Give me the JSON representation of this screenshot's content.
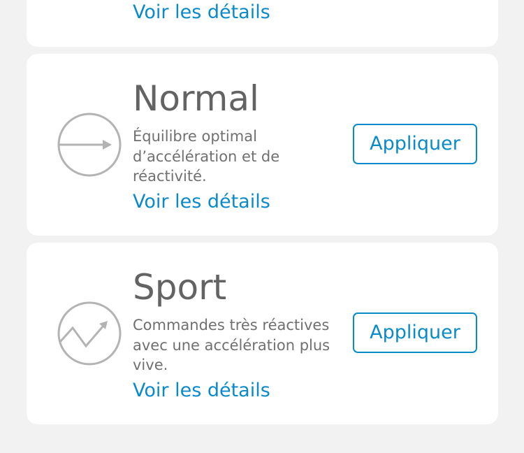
{
  "colors": {
    "background": "#f2f2f2",
    "card": "#ffffff",
    "accent": "#0a8ac8",
    "title_text": "#636363",
    "body_text": "#707070",
    "icon_stroke": "#b3b3b3"
  },
  "previous_mode": {
    "details_label": "Voir les détails"
  },
  "modes": [
    {
      "title": "Normal",
      "description": "Équilibre optimal d’accélération et de réactivité.",
      "details_label": "Voir les détails",
      "apply_label": "Appliquer",
      "icon": "arrow-right-circle-icon"
    },
    {
      "title": "Sport",
      "description": "Commandes très réactives avec une accélération plus vive.",
      "details_label": "Voir les détails",
      "apply_label": "Appliquer",
      "icon": "zigzag-arrow-circle-icon"
    }
  ]
}
